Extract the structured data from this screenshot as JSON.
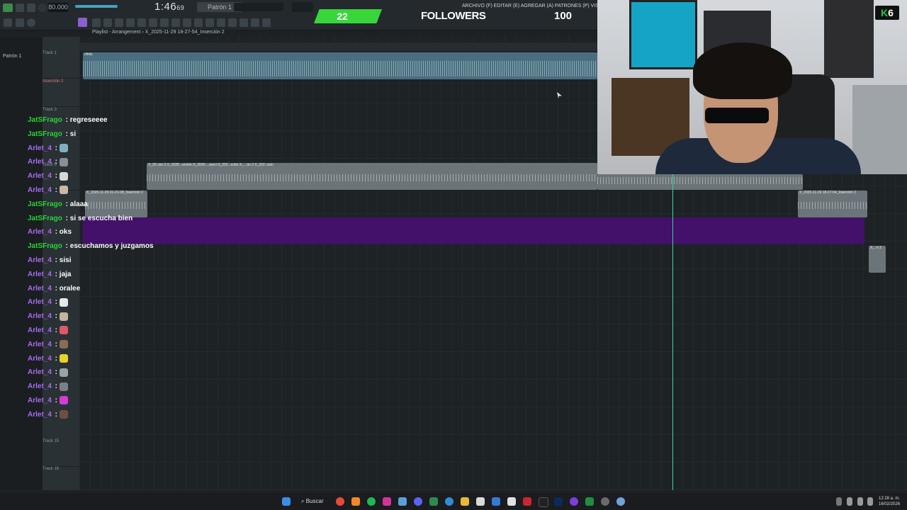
{
  "transport": {
    "bpm": "80.000",
    "time": "1:46",
    "time_small": "69",
    "pattern": "Patrón 1"
  },
  "menu": {
    "text": "ARCHIVO (F)  EDITAR (E)  AGREGAR (A)  PATRONES (P)  VISTA (V)  OPCIONES ("
  },
  "followers": {
    "count": "22",
    "label": "FOLLOWERS",
    "goal": "100"
  },
  "playlist": {
    "title": "Playlist - Arrangement › X_2025-11-29 18-27-54_Inserción 2",
    "browser_item": "Patrón 1"
  },
  "tracks": [
    {
      "label": "Track 1"
    },
    {
      "label": "Inserción 2"
    },
    {
      "label": "Track 3"
    },
    {
      "label": "Track 5"
    },
    {
      "label": "Track 15"
    },
    {
      "label": "Track 16"
    }
  ],
  "clips": {
    "top_label": "cfmix",
    "gray_label": "X_20..ión 2  X_2025...erción  X_2025-...serci  X_202...rción  X_...ón 2  X_202..ción",
    "small_left_label": "X_2025-11-29 01-21-08_Inserción 2",
    "small_right_label": "X_2025-11-29 18-27-54_Inserción 2",
    "tiny_right_label": "X_..n 2"
  },
  "chat": [
    {
      "user": "JatSFrago",
      "color": "#29d534",
      "text": "regreseeee"
    },
    {
      "user": "JatSFrago",
      "color": "#29d534",
      "text": "si"
    },
    {
      "user": "Arlet_4",
      "color": "#a86cf0",
      "text": "",
      "emote": "#7fb0c2"
    },
    {
      "user": "Arlet_4",
      "color": "#a86cf0",
      "text": "",
      "emote": "#8a8f97"
    },
    {
      "user": "Arlet_4",
      "color": "#a86cf0",
      "text": "",
      "emote": "#d7d7d7"
    },
    {
      "user": "Arlet_4",
      "color": "#a86cf0",
      "text": "",
      "emote": "#c8b9a5"
    },
    {
      "user": "JatSFrago",
      "color": "#29d534",
      "text": "alaaa"
    },
    {
      "user": "JatSFrago",
      "color": "#29d534",
      "text": "si se escucha bien"
    },
    {
      "user": "Arlet_4",
      "color": "#a86cf0",
      "text": "oks"
    },
    {
      "user": "JatSFrago",
      "color": "#29d534",
      "text": "escuchamos y juzgamos"
    },
    {
      "user": "Arlet_4",
      "color": "#a86cf0",
      "text": "sisi"
    },
    {
      "user": "Arlet_4",
      "color": "#a86cf0",
      "text": "jaja"
    },
    {
      "user": "Arlet_4",
      "color": "#a86cf0",
      "text": "oralee"
    },
    {
      "user": "Arlet_4",
      "color": "#a86cf0",
      "text": "",
      "emote": "#e8e8e8"
    },
    {
      "user": "Arlet_4",
      "color": "#a86cf0",
      "text": "",
      "emote": "#c4b49e"
    },
    {
      "user": "Arlet_4",
      "color": "#a86cf0",
      "text": "",
      "emote": "#e0566a"
    },
    {
      "user": "Arlet_4",
      "color": "#a86cf0",
      "text": "",
      "emote": "#8b6b55"
    },
    {
      "user": "Arlet_4",
      "color": "#a86cf0",
      "text": "",
      "emote": "#e6d32c"
    },
    {
      "user": "Arlet_4",
      "color": "#a86cf0",
      "text": "",
      "emote": "#9aa3aa"
    },
    {
      "user": "Arlet_4",
      "color": "#a86cf0",
      "text": "",
      "emote": "#7b8088"
    },
    {
      "user": "Arlet_4",
      "color": "#a86cf0",
      "text": "",
      "emote": "#d43bd8"
    },
    {
      "user": "Arlet_4",
      "color": "#a86cf0",
      "text": "",
      "emote": "#6c4f45"
    }
  ],
  "overlay": {
    "k": "K",
    "k_num": "6"
  },
  "taskbar": {
    "search_label": "Buscar",
    "time": "12:28 a. m.",
    "date": "16/02/2026"
  },
  "colors": {
    "accent_green": "#38d63a",
    "purple_clip": "#43106a",
    "playhead": "#39d0a2"
  }
}
